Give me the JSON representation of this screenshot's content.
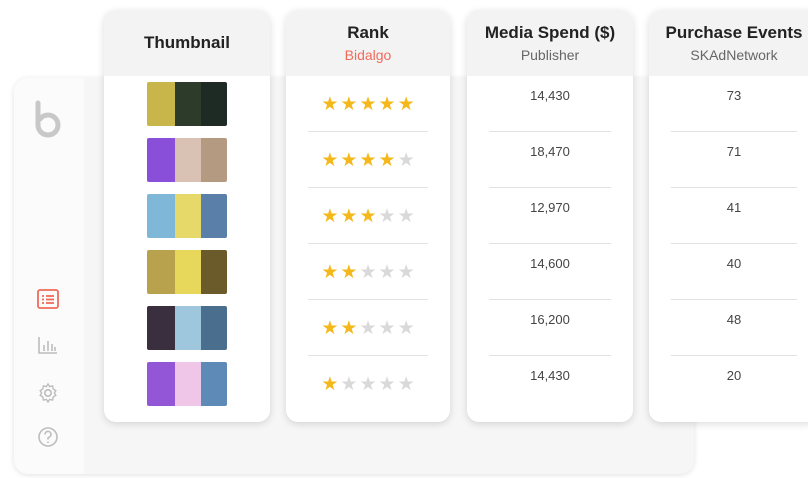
{
  "sidebar": {
    "logo_icon": "bidalgo-b-logo",
    "icons": [
      {
        "name": "list-icon",
        "active": true,
        "color": "#f06a5a"
      },
      {
        "name": "bar-chart-icon",
        "active": false
      },
      {
        "name": "gear-icon",
        "active": false
      },
      {
        "name": "help-icon",
        "active": false
      }
    ]
  },
  "columns": {
    "thumbnail": {
      "title": "Thumbnail"
    },
    "rank": {
      "title": "Rank",
      "subtitle": "Bidalgo"
    },
    "spend": {
      "title": "Media Spend ($)",
      "subtitle": "Publisher"
    },
    "events": {
      "title": "Purchase Events",
      "subtitle": "SKAdNetwork"
    }
  },
  "rows": [
    {
      "stars": 5,
      "spend": "14,430",
      "events": "73",
      "thumb_colors": [
        "#c9b64a",
        "#2d3b2a",
        "#1e2a24"
      ]
    },
    {
      "stars": 4,
      "spend": "18,470",
      "events": "71",
      "thumb_colors": [
        "#8a4fd8",
        "#d9c2b4",
        "#b59a82"
      ]
    },
    {
      "stars": 3,
      "spend": "12,970",
      "events": "41",
      "thumb_colors": [
        "#7fb7d8",
        "#e6d96a",
        "#5a7fa8"
      ]
    },
    {
      "stars": 2,
      "spend": "14,600",
      "events": "40",
      "thumb_colors": [
        "#b8a24e",
        "#e7d85c",
        "#6b5a2a"
      ]
    },
    {
      "stars": 2,
      "spend": "16,200",
      "events": "48",
      "thumb_colors": [
        "#3a2f3e",
        "#9ec6dc",
        "#4a6f8e"
      ]
    },
    {
      "stars": 1,
      "spend": "14,430",
      "events": "20",
      "thumb_colors": [
        "#9256d6",
        "#f0c6e8",
        "#5e8ab8"
      ]
    }
  ],
  "colors": {
    "accent": "#f06a5a",
    "star_on": "#f5b81b",
    "star_off": "#d9d9d9"
  }
}
